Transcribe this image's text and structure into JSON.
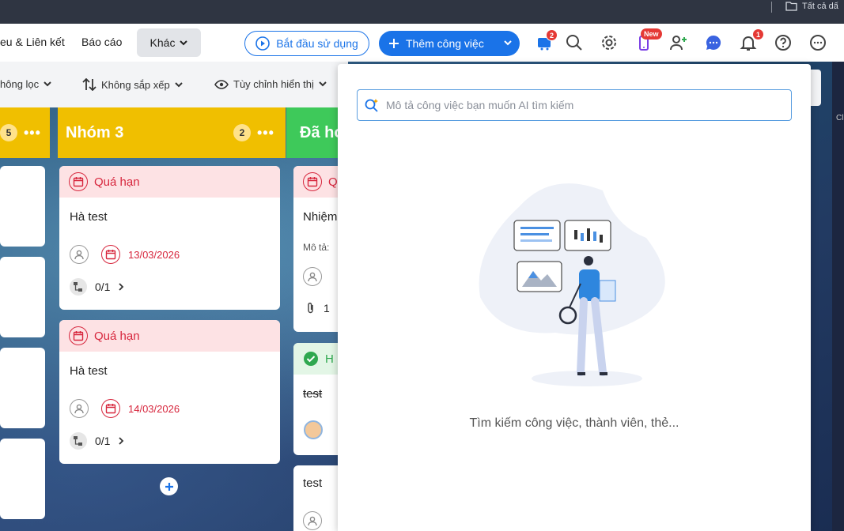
{
  "topbar": {
    "folder_label": "Tất cả dấ"
  },
  "nav": {
    "item_links": "eu & Liên kết",
    "item_report": "Báo cáo",
    "more_label": "Khác",
    "start_label": "Bắt đầu sử dụng",
    "add_task_label": "Thêm công việc",
    "cart_badge": "2",
    "new_badge": "New",
    "bell_badge": "1"
  },
  "filters": {
    "filter_label": "hông lọc",
    "sort_label": "Không sắp xếp",
    "display_label": "Tùy chỉnh hiển thị"
  },
  "columns": {
    "prev": {
      "count": "5"
    },
    "group3": {
      "title": "Nhóm 3",
      "count": "2"
    },
    "done": {
      "title": "Đã hoà"
    }
  },
  "cards": {
    "c1": {
      "status": "Quá hạn",
      "title": "Hà test",
      "date": "13/03/2026",
      "subtasks": "0/1"
    },
    "c2": {
      "status": "Quá hạn",
      "title": "Hà test",
      "date": "14/03/2026",
      "subtasks": "0/1"
    },
    "d1": {
      "status": "Q",
      "title": "Nhiệm",
      "desc": "Mô tả:",
      "attach": "1"
    },
    "d2": {
      "status": "H",
      "title": "test"
    },
    "d3": {
      "title": "test"
    }
  },
  "panel": {
    "search_placeholder": "Mô tả công việc bạn muốn AI tìm kiếm",
    "empty_text": "Tìm kiếm công việc, thành viên, thẻ..."
  },
  "right_edge": {
    "label": "Cl"
  },
  "colors": {
    "accent": "#1a73e8",
    "overdue": "#d7263d",
    "group_yellow": "#f0bf00",
    "done_green": "#3ec95a"
  }
}
